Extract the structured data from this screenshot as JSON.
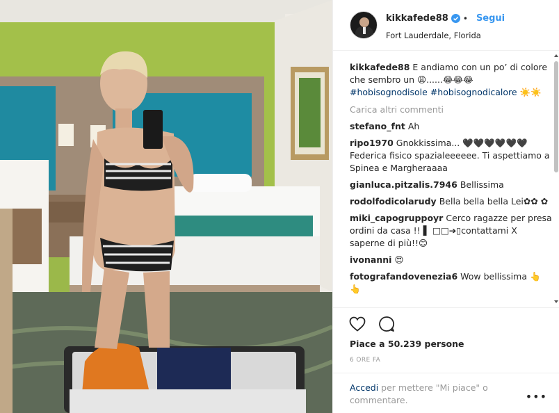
{
  "post": {
    "photo_alt": "",
    "header": {
      "username": "kikkafede88",
      "separator": "•",
      "follow_label": "Segui",
      "location": "Fort Lauderdale, Florida"
    },
    "caption": {
      "username": "kikkafede88",
      "text": "E andiamo con un po’ di colore che sembro un 😩......😂😂😂",
      "hashtags": "#hobisognodisole #hobisognodicalore ☀️☀️"
    },
    "load_more": "Carica altri commenti",
    "comments": [
      {
        "user": "stefano_fnt",
        "text": "Ah"
      },
      {
        "user": "ripo1970",
        "text": "Gnokkissima... 🖤🖤🖤🖤🖤🖤 Federica fisico spazialeeeeee. Ti aspettiamo a Spinea e Margheraaaa"
      },
      {
        "user": "gianluca.pitzalis.7946",
        "text": "Bellissima"
      },
      {
        "user": "rodolfodicolarudy",
        "text": "Bella bella bella Lei✿✿ ✿"
      },
      {
        "user": "miki_capogruppoyr",
        "text": "Cerco ragazze per presa ordini da casa !! ▌ □□➔▯contattami X saperne di più!!😊"
      },
      {
        "user": "ivonanni",
        "text": "😍"
      },
      {
        "user": "fotografandovenezia6",
        "text": "Wow bellissima 👆 👆"
      }
    ],
    "likes_text": "Piace a 50.239 persone",
    "time_ago": "6 ORE FA",
    "add_comment": {
      "link": "Accedi",
      "rest": " per mettere \"Mi piace\" o commentare."
    },
    "more_options": "•••",
    "icons": {
      "like": "heart-icon",
      "comment": "comment-icon",
      "verified": "verified-badge-icon",
      "more": "more-options-icon"
    },
    "colors": {
      "link_blue": "#3897f0",
      "hashtag": "#003569",
      "text": "#262626",
      "muted": "#999999",
      "border": "#efefef"
    }
  }
}
